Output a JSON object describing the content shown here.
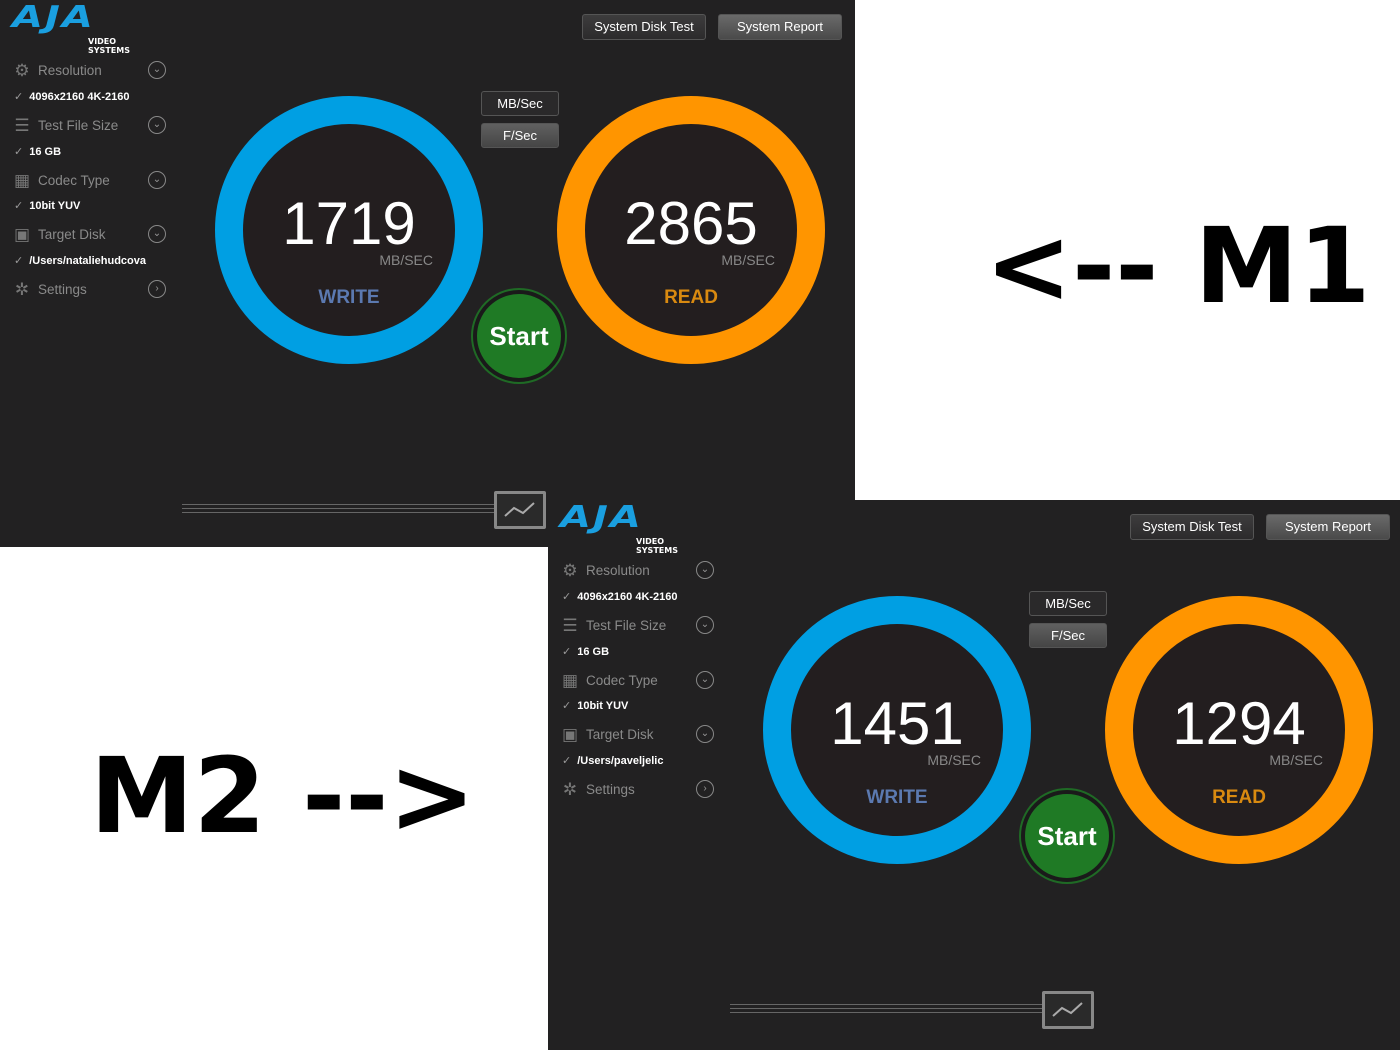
{
  "windows": [
    {
      "id": "m1",
      "logo": "AJA VIDEO SYSTEMS",
      "logo_main": "AJA",
      "logo_sub": "VIDEO SYSTEMS",
      "buttons": {
        "disk_test": "System Disk Test",
        "report": "System Report"
      },
      "sidebar": [
        {
          "label": "Resolution",
          "icon": "chip-icon",
          "value": "4096x2160 4K-2160",
          "chevron": "down"
        },
        {
          "label": "Test File Size",
          "icon": "stack-icon",
          "value": "16 GB",
          "chevron": "down"
        },
        {
          "label": "Codec Type",
          "icon": "grid-icon",
          "value": "10bit YUV",
          "chevron": "down"
        },
        {
          "label": "Target Disk",
          "icon": "disk-icon",
          "value": "/Users/nataliehudcova",
          "chevron": "down"
        },
        {
          "label": "Settings",
          "icon": "gear-icon",
          "chevron": "right"
        }
      ],
      "units": {
        "mb": "MB/Sec",
        "f": "F/Sec"
      },
      "write": {
        "value": "1719",
        "unit": "MB/SEC",
        "label": "WRITE"
      },
      "read": {
        "value": "2865",
        "unit": "MB/SEC",
        "label": "READ"
      },
      "start": "Start"
    },
    {
      "id": "m2",
      "logo": "AJA VIDEO SYSTEMS",
      "logo_main": "AJA",
      "logo_sub": "VIDEO SYSTEMS",
      "buttons": {
        "disk_test": "System Disk Test",
        "report": "System Report"
      },
      "sidebar": [
        {
          "label": "Resolution",
          "icon": "chip-icon",
          "value": "4096x2160 4K-2160",
          "chevron": "down"
        },
        {
          "label": "Test File Size",
          "icon": "stack-icon",
          "value": "16 GB",
          "chevron": "down"
        },
        {
          "label": "Codec Type",
          "icon": "grid-icon",
          "value": "10bit YUV",
          "chevron": "down"
        },
        {
          "label": "Target Disk",
          "icon": "disk-icon",
          "value": "/Users/paveljelic",
          "chevron": "down"
        },
        {
          "label": "Settings",
          "icon": "gear-icon",
          "chevron": "right"
        }
      ],
      "units": {
        "mb": "MB/Sec",
        "f": "F/Sec"
      },
      "write": {
        "value": "1451",
        "unit": "MB/SEC",
        "label": "WRITE"
      },
      "read": {
        "value": "1294",
        "unit": "MB/SEC",
        "label": "READ"
      },
      "start": "Start"
    }
  ],
  "annotations": {
    "m1": "<-- M1",
    "m2": "M2 -->"
  },
  "colors": {
    "write": "#009fe3",
    "read": "#ff9500",
    "write_label": "#5b79b0",
    "read_label": "#d98a10",
    "start": "#1f7a25",
    "bg": "#222122"
  }
}
